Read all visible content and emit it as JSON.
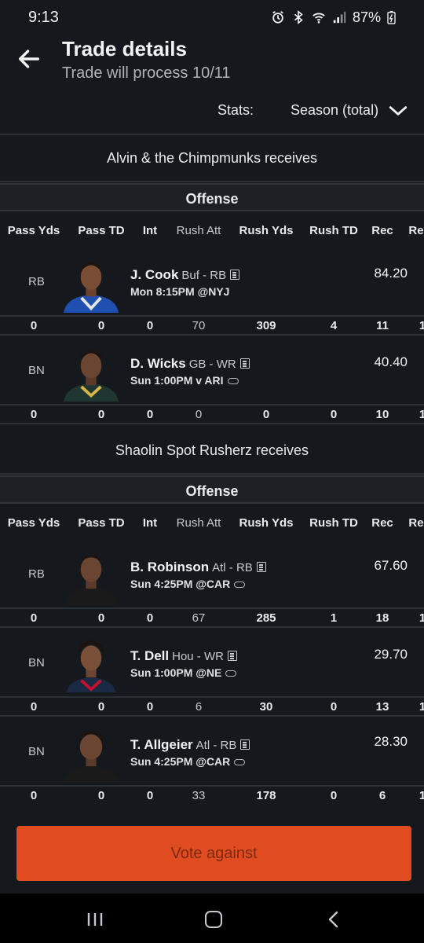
{
  "status_bar": {
    "time": "9:13",
    "battery": "87%"
  },
  "header": {
    "title": "Trade details",
    "subtitle": "Trade will process 10/11"
  },
  "stats_filter": {
    "label": "Stats:",
    "value": "Season (total)"
  },
  "columns": [
    "Pass Yds",
    "Pass TD",
    "Int",
    "Rush Att",
    "Rush Yds",
    "Rush TD",
    "Rec",
    "Re"
  ],
  "sections": [
    {
      "team": "Alvin & the Chimpmunks receives",
      "group": "Offense",
      "players": [
        {
          "pos": "RB",
          "name": "J. Cook",
          "team": "Buf - RB",
          "game": "Mon 8:15PM @NYJ",
          "points": "84.20",
          "stats": [
            "0",
            "0",
            "0",
            "70",
            "309",
            "4",
            "11",
            "1"
          ],
          "jersey": "#1f4fb0",
          "weather": false
        },
        {
          "pos": "BN",
          "name": "D. Wicks",
          "team": "GB - WR",
          "game": "Sun 1:00PM v ARI",
          "points": "40.40",
          "stats": [
            "0",
            "0",
            "0",
            "0",
            "0",
            "0",
            "10",
            "1"
          ],
          "jersey": "#203731",
          "weather": true
        }
      ]
    },
    {
      "team": "Shaolin Spot Rusherz receives",
      "group": "Offense",
      "players": [
        {
          "pos": "RB",
          "name": "B. Robinson",
          "team": "Atl - RB",
          "game": "Sun 4:25PM @CAR",
          "points": "67.60",
          "stats": [
            "0",
            "0",
            "0",
            "67",
            "285",
            "1",
            "18",
            "1"
          ],
          "jersey": "#1a1a1a",
          "weather": true
        },
        {
          "pos": "BN",
          "name": "T. Dell",
          "team": "Hou - WR",
          "game": "Sun 1:00PM @NE",
          "points": "29.70",
          "stats": [
            "0",
            "0",
            "0",
            "6",
            "30",
            "0",
            "13",
            "1"
          ],
          "jersey": "#2a1f3d",
          "weather": true
        },
        {
          "pos": "BN",
          "name": "T. Allgeier",
          "team": "Atl - RB",
          "game": "Sun 4:25PM @CAR",
          "points": "28.30",
          "stats": [
            "0",
            "0",
            "0",
            "33",
            "178",
            "0",
            "6",
            "1"
          ],
          "jersey": "#1a1a1a",
          "weather": true
        }
      ]
    }
  ],
  "vote_button": {
    "label": "Vote against"
  }
}
